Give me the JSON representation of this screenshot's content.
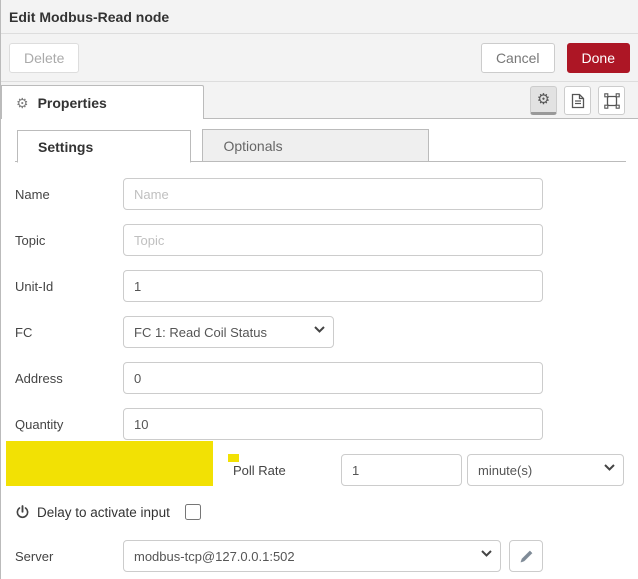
{
  "header": {
    "title": "Edit Modbus-Read node"
  },
  "toolbar": {
    "delete_label": "Delete",
    "cancel_label": "Cancel",
    "done_label": "Done"
  },
  "tabs": {
    "properties_label": "Properties",
    "icon_buttons": [
      "properties-gear",
      "description-doc",
      "appearance-frame"
    ],
    "active_icon": "properties-gear"
  },
  "subtabs": {
    "settings_label": "Settings",
    "optionals_label": "Optionals",
    "active": "Settings"
  },
  "form": {
    "name": {
      "label": "Name",
      "placeholder": "Name",
      "value": ""
    },
    "topic": {
      "label": "Topic",
      "placeholder": "Topic",
      "value": ""
    },
    "unit_id": {
      "label": "Unit-Id",
      "value": "1"
    },
    "fc": {
      "label": "FC",
      "selected": "FC 1: Read Coil Status"
    },
    "address": {
      "label": "Address",
      "value": "0"
    },
    "quantity": {
      "label": "Quantity",
      "value": "10"
    },
    "poll_rate": {
      "label": "Poll Rate",
      "value": "1",
      "unit_selected": "minute(s)",
      "highlighted": true
    },
    "delay": {
      "label": "Delay to activate input",
      "checked": false
    },
    "server": {
      "label": "Server",
      "selected": "modbus-tcp@127.0.0.1:502"
    }
  },
  "icons": {
    "gear": "⚙"
  },
  "colors": {
    "done_red": "#ad1625",
    "highlight_yellow": "#f2e104",
    "tray_bg": "#f3f3f3",
    "border": "#bbbbbb"
  }
}
